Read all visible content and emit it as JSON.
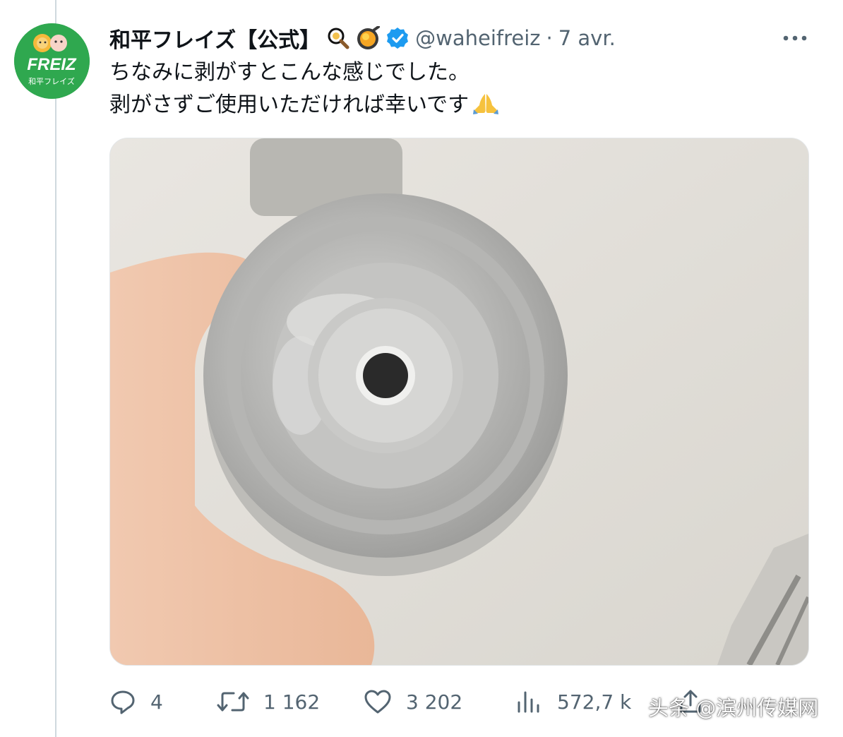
{
  "tweet": {
    "avatar": {
      "logo_text": "FREIZ",
      "sub_text": "和平フレイズ",
      "color": "#2fa84f"
    },
    "display_name": "和平フレイズ【公式】",
    "badges": [
      "magnifier-badge-icon",
      "fried-egg-badge-icon",
      "verified-icon"
    ],
    "handle": "@waheifreiz",
    "separator": "·",
    "date": "7 avr.",
    "text_lines": [
      "ちなみに剥がすとこんな感じでした。",
      "剥がさずご使用いただければ幸いです"
    ],
    "emoji": "folded-hands-icon"
  },
  "actions": {
    "replies": "4",
    "retweets": "1 162",
    "likes": "3 202",
    "views": "572,7 k"
  },
  "watermark": "头条 @滨州传媒网",
  "colors": {
    "text": "#0f1419",
    "muted": "#536471",
    "verified": "#1d9bf0",
    "brand_green": "#2fa84f"
  }
}
